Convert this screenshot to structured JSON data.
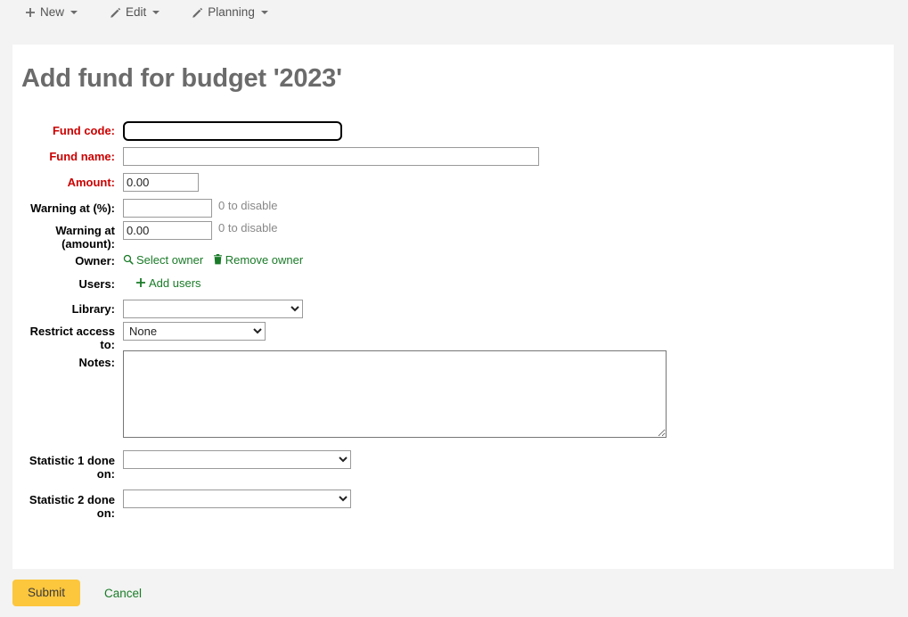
{
  "toolbar": {
    "items": [
      {
        "label": "New",
        "icon": "plus-icon",
        "caret": true
      },
      {
        "label": "Edit",
        "icon": "pencil-icon",
        "caret": true
      },
      {
        "label": "Planning",
        "icon": "pencil-icon",
        "caret": true
      }
    ]
  },
  "page": {
    "title": "Add fund for budget '2023'"
  },
  "form": {
    "fund_code": {
      "label": "Fund code:",
      "value": "",
      "required": true
    },
    "fund_name": {
      "label": "Fund name:",
      "value": "",
      "required": true
    },
    "amount": {
      "label": "Amount:",
      "value": "0.00",
      "required": true
    },
    "warning_percent": {
      "label": "Warning at (%):",
      "value": "",
      "hint": "0 to disable"
    },
    "warning_amount": {
      "label": "Warning at (amount):",
      "value": "0.00",
      "hint": "0 to disable"
    },
    "owner": {
      "label": "Owner:",
      "select_link": "Select owner",
      "select_icon": "search-icon",
      "remove_link": "Remove owner",
      "remove_icon": "trash-icon"
    },
    "users": {
      "label": "Users:",
      "add_link": "Add users",
      "add_icon": "plus-icon"
    },
    "library": {
      "label": "Library:",
      "selected": "",
      "options": [
        ""
      ]
    },
    "restrict_access": {
      "label": "Restrict access to:",
      "selected": "None",
      "options": [
        "None"
      ]
    },
    "notes": {
      "label": "Notes:",
      "value": ""
    },
    "statistic_1": {
      "label": "Statistic 1 done on:",
      "selected": "",
      "options": [
        ""
      ]
    },
    "statistic_2": {
      "label": "Statistic 2 done on:",
      "selected": "",
      "options": [
        ""
      ]
    }
  },
  "footer": {
    "submit_label": "Submit",
    "cancel_label": "Cancel"
  },
  "colors": {
    "required_label": "#cc0000",
    "link_green": "#1a7b28",
    "submit_yellow": "#fcc63d",
    "title_gray": "#6b6b6b",
    "page_bg": "#f2f3f2"
  }
}
